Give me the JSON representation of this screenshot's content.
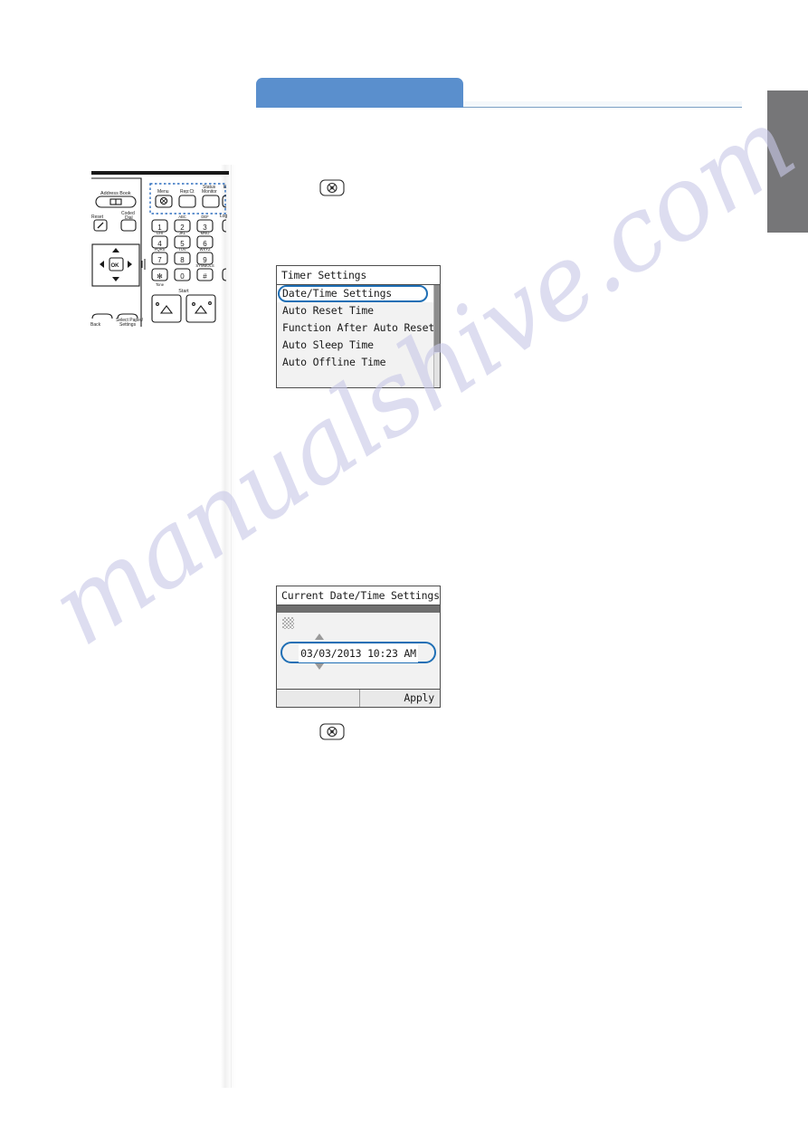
{
  "header": {
    "chapter_tab_label": "",
    "section_tab_label": ""
  },
  "illustration": {
    "name": "printer-control-panel",
    "labels": {
      "address_book": "Address Book",
      "reset": "Reset",
      "coded_dial": "Coded Dial",
      "menu": "Menu",
      "reset_ct": "Rep:Ct",
      "status_monitor": "Status Monitor",
      "back": "Back",
      "select_paper_settings": "Select Paper/ Settings",
      "start": "Start",
      "ok": "OK",
      "log": "Log",
      "keys": [
        {
          "digit": "1",
          "letters": ""
        },
        {
          "digit": "2",
          "letters": "ABC"
        },
        {
          "digit": "3",
          "letters": "DEF"
        },
        {
          "digit": "4",
          "letters": "GHI"
        },
        {
          "digit": "5",
          "letters": "JKL"
        },
        {
          "digit": "6",
          "letters": "MNO"
        },
        {
          "digit": "7",
          "letters": "PQRS"
        },
        {
          "digit": "8",
          "letters": "TUV"
        },
        {
          "digit": "9",
          "letters": "WXYZ"
        },
        {
          "digit": "✶",
          "letters": "Tone"
        },
        {
          "digit": "0",
          "letters": ""
        },
        {
          "digit": "#",
          "letters": "SYMBOLS"
        }
      ]
    }
  },
  "steps": {
    "menu_key_icon": "menu-key-icon"
  },
  "screens": {
    "timer_settings": {
      "title": "Timer Settings",
      "items": [
        {
          "label": "Date/Time Settings",
          "selected": true
        },
        {
          "label": "Auto Reset Time",
          "selected": false
        },
        {
          "label": "Function After Auto Reset",
          "selected": false
        },
        {
          "label": "Auto Sleep Time",
          "selected": false
        },
        {
          "label": "Auto Offline Time",
          "selected": false
        }
      ]
    },
    "current_datetime": {
      "title": "Current Date/Time Settings",
      "value": "03/03/2013 10:23 AM",
      "apply_label": "Apply"
    }
  },
  "watermark": {
    "text": "manualshive.com"
  },
  "colors": {
    "chapter_tab": "#5a8fcd",
    "section_tab": "#767678",
    "lcd_selection": "#1f6fb5",
    "header_rule": "#7b9fc4"
  }
}
